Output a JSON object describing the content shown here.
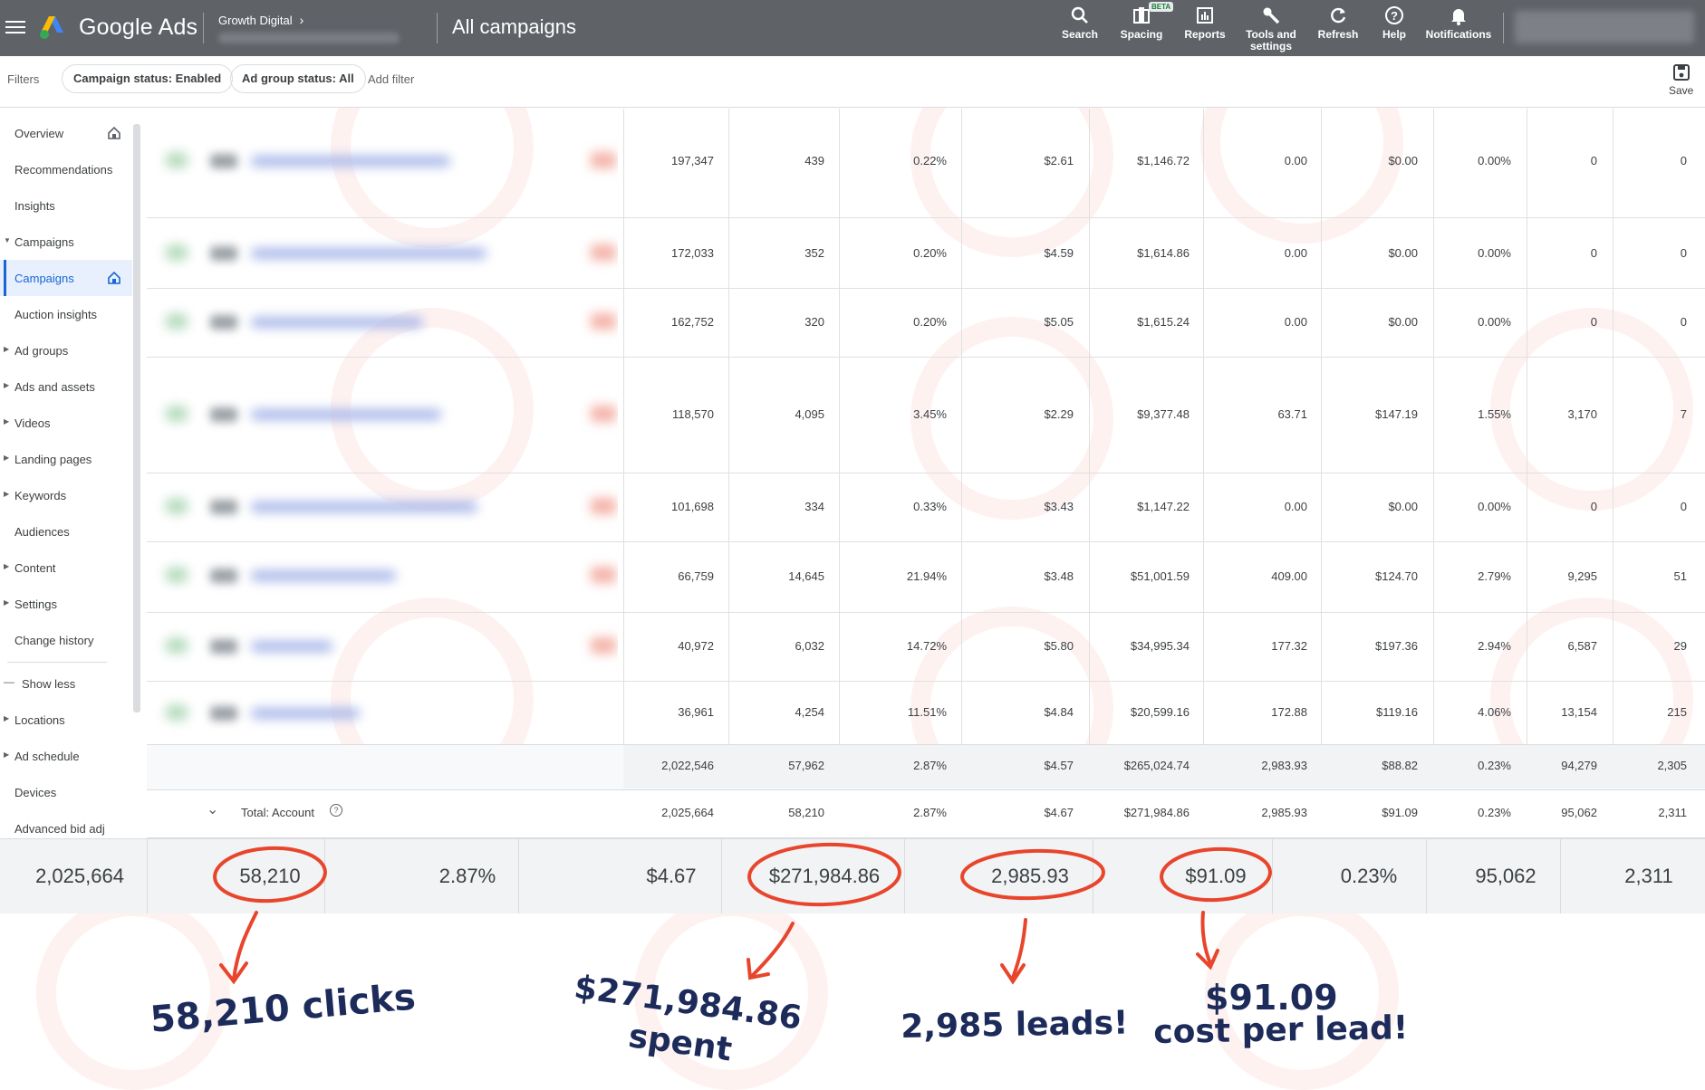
{
  "topbar": {
    "brand": "Google Ads",
    "account_name": "Growth Digital",
    "page_title": "All campaigns",
    "tools": [
      {
        "label": "Search",
        "icon": "search-icon"
      },
      {
        "label": "Spacing",
        "icon": "spacing-icon",
        "badge": "BETA"
      },
      {
        "label": "Reports",
        "icon": "reports-icon"
      },
      {
        "label": "Tools and settings",
        "icon": "wrench-icon"
      },
      {
        "label": "Refresh",
        "icon": "refresh-icon"
      },
      {
        "label": "Help",
        "icon": "help-icon"
      },
      {
        "label": "Notifications",
        "icon": "bell-icon"
      }
    ]
  },
  "filters": {
    "label": "Filters",
    "chips": [
      "Campaign status: Enabled",
      "Ad group status: All"
    ],
    "add_filter": "Add filter",
    "save_label": "Save"
  },
  "sidebar": {
    "items": [
      {
        "label": "Overview",
        "home": true
      },
      {
        "label": "Recommendations"
      },
      {
        "label": "Insights"
      },
      {
        "label": "Campaigns",
        "expanded": true
      },
      {
        "label": "Campaigns",
        "active": true,
        "home": true
      },
      {
        "label": "Auction insights"
      },
      {
        "label": "Ad groups",
        "collapsed": true
      },
      {
        "label": "Ads and assets",
        "collapsed": true
      },
      {
        "label": "Videos",
        "collapsed": true
      },
      {
        "label": "Landing pages",
        "collapsed": true
      },
      {
        "label": "Keywords",
        "collapsed": true
      },
      {
        "label": "Audiences"
      },
      {
        "label": "Content",
        "collapsed": true
      },
      {
        "label": "Settings",
        "collapsed": true
      },
      {
        "label": "Change history"
      },
      {
        "label": "Show less"
      },
      {
        "label": "Locations",
        "collapsed": true
      },
      {
        "label": "Ad schedule",
        "collapsed": true
      },
      {
        "label": "Devices"
      },
      {
        "label": "Advanced bid adj"
      }
    ]
  },
  "table": {
    "rows": [
      [
        "197,347",
        "439",
        "0.22%",
        "$2.61",
        "$1,146.72",
        "0.00",
        "$0.00",
        "0.00%",
        "0",
        "0"
      ],
      [
        "172,033",
        "352",
        "0.20%",
        "$4.59",
        "$1,614.86",
        "0.00",
        "$0.00",
        "0.00%",
        "0",
        "0"
      ],
      [
        "162,752",
        "320",
        "0.20%",
        "$5.05",
        "$1,615.24",
        "0.00",
        "$0.00",
        "0.00%",
        "0",
        "0"
      ],
      [
        "118,570",
        "4,095",
        "3.45%",
        "$2.29",
        "$9,377.48",
        "63.71",
        "$147.19",
        "1.55%",
        "3,170",
        "7"
      ],
      [
        "101,698",
        "334",
        "0.33%",
        "$3.43",
        "$1,147.22",
        "0.00",
        "$0.00",
        "0.00%",
        "0",
        "0"
      ],
      [
        "66,759",
        "14,645",
        "21.94%",
        "$3.48",
        "$51,001.59",
        "409.00",
        "$124.70",
        "2.79%",
        "9,295",
        "51"
      ],
      [
        "40,972",
        "6,032",
        "14.72%",
        "$5.80",
        "$34,995.34",
        "177.32",
        "$197.36",
        "2.94%",
        "6,587",
        "29"
      ],
      [
        "36,961",
        "4,254",
        "11.51%",
        "$4.84",
        "$20,599.16",
        "172.88",
        "$119.16",
        "4.06%",
        "13,154",
        "215"
      ]
    ],
    "subtotal": [
      "2,022,546",
      "57,962",
      "2.87%",
      "$4.57",
      "$265,024.74",
      "2,983.93",
      "$88.82",
      "0.23%",
      "94,279",
      "2,305"
    ],
    "total_label": "Total: Account",
    "total": [
      "2,025,664",
      "58,210",
      "2.87%",
      "$4.67",
      "$271,984.86",
      "2,985.93",
      "$91.09",
      "0.23%",
      "95,062",
      "2,311"
    ]
  },
  "summary": [
    "2,025,664",
    "58,210",
    "2.87%",
    "$4.67",
    "$271,984.86",
    "2,985.93",
    "$91.09",
    "0.23%",
    "95,062",
    "2,311"
  ],
  "annotations": {
    "clicks": "58,210 clicks",
    "spent_amount": "$271,984.86",
    "spent_word": "spent",
    "leads": "2,985 leads!",
    "cpl_amount": "$91.09",
    "cpl_text": "cost per lead!"
  },
  "colors": {
    "topbar": "#5f6368",
    "accent": "#1967d2",
    "annotation_red": "#e8452c",
    "annotation_ink": "#1c2b5a"
  }
}
